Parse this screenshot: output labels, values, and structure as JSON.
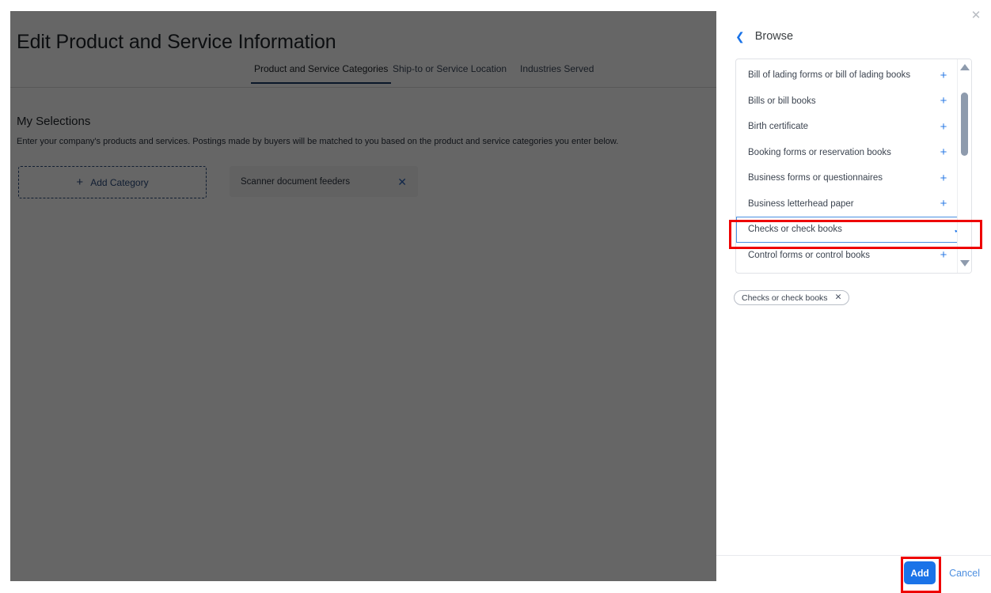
{
  "background_page": {
    "title": "Edit Product and Service Information",
    "tabs": [
      {
        "label": "Product and Service Categories",
        "active": true
      },
      {
        "label": "Ship-to or Service Location",
        "active": false
      },
      {
        "label": "Industries Served",
        "active": false
      }
    ],
    "section": {
      "title": "My Selections",
      "description": "Enter your company's products and services. Postings made by buyers will be matched to you based on the product and service categories you enter below."
    },
    "add_category_button": {
      "label": "Add Category",
      "plus_icon": "plus-icon"
    },
    "selected_categories": [
      {
        "label": "Scanner document feeders",
        "remove_icon": "close-icon"
      }
    ]
  },
  "panel": {
    "close_icon": "close-icon",
    "back_icon": "chevron-left-icon",
    "title": "Browse",
    "list": [
      {
        "label": "Bill of lading forms or bill of lading books",
        "action": "+",
        "selected": false
      },
      {
        "label": "Bills or bill books",
        "action": "+",
        "selected": false
      },
      {
        "label": "Birth certificate",
        "action": "+",
        "selected": false
      },
      {
        "label": "Booking forms or reservation books",
        "action": "+",
        "selected": false
      },
      {
        "label": "Business forms or questionnaires",
        "action": "+",
        "selected": false
      },
      {
        "label": "Business letterhead paper",
        "action": "+",
        "selected": false
      },
      {
        "label": "Checks or check books",
        "action": "✓",
        "selected": true
      },
      {
        "label": "Control forms or control books",
        "action": "+",
        "selected": false
      }
    ],
    "scrollbar": {
      "up_icon": "scroll-up-arrow-icon",
      "down_icon": "scroll-down-arrow-icon"
    },
    "chips": [
      {
        "label": "Checks or check books",
        "remove_icon": "close-icon"
      }
    ],
    "footer": {
      "add_label": "Add",
      "cancel_label": "Cancel"
    }
  },
  "colors": {
    "accent_blue": "#1a73e8",
    "list_action_blue": "#2c7be5",
    "annotation_red": "#ee0000",
    "tab_underline": "#1b3a66",
    "overlay": "rgba(0,0,0,0.6)"
  }
}
